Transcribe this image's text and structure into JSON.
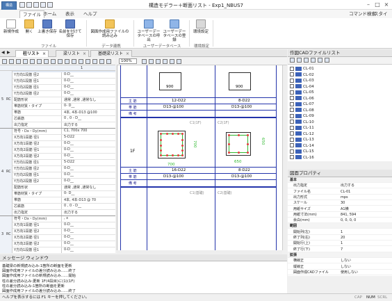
{
  "titlebar": {
    "title": "構造モデラー＋断面リスト - Exp1_NBUS7"
  },
  "ribbon": {
    "tabs": [
      "ファイル",
      "ホーム",
      "表示",
      "ヘルプ"
    ],
    "right_items": [
      "コマンド検索",
      "スタイル"
    ],
    "buttons": [
      {
        "label": "新規作成"
      },
      {
        "label": "開く"
      },
      {
        "label": "上書き保存"
      },
      {
        "label": "名前を付けて保存"
      },
      {
        "label": "図面作成用ファイルの読み込み"
      },
      {
        "label": "ユーザーデータベースの呼出"
      },
      {
        "label": "ユーザーデータベースの登録"
      },
      {
        "label": "環境設定"
      }
    ],
    "groups": [
      "ファイル",
      "データ連携",
      "ユーザーデータベース",
      "環境設定"
    ]
  },
  "doc_tabs": [
    "柱リスト",
    "梁リスト",
    "基礎梁リスト"
  ],
  "left_grid": {
    "header_col": "1",
    "rows": [
      {
        "floor": "5",
        "kind": "RC",
        "items": [
          {
            "k": "Y方向1段筋 径2",
            "v": "0-D__"
          },
          {
            "k": "Y方向1段筋 径1",
            "v": "0-D__"
          },
          {
            "k": "Y方向2段筋 径1",
            "v": "0-D__"
          },
          {
            "k": "Y方向2段筋 径2",
            "v": "0-D__"
          },
          {
            "k": "配筋形状",
            "v": "通常 ,通常 ,通常なし"
          },
          {
            "k": "帯筋材質・タイプ",
            "v": "0- D__"
          },
          {
            "k": "帯筋",
            "v": "4本, 4本-D13 @100"
          },
          {
            "k": "芯鉄筋",
            "v": "0 , 0 - D__"
          },
          {
            "k": "出力指定",
            "v": "出力する"
          }
        ]
      },
      {
        "floor": "4",
        "kind": "RC",
        "items": [
          {
            "k": "符号・Dx・Dy(mm)",
            "v": "C1, 700x 700"
          },
          {
            "k": "X方向1段筋 径1",
            "v": "5-D22"
          },
          {
            "k": "X方向1段筋 径2",
            "v": "0-D__"
          },
          {
            "k": "X方向2段筋 径1",
            "v": "0-D__"
          },
          {
            "k": "X方向2段筋 径2",
            "v": "0-D__"
          },
          {
            "k": "Y方向1段筋 径1",
            "v": "5-D22"
          },
          {
            "k": "Y方向1段筋 径2",
            "v": "0-D__"
          },
          {
            "k": "Y方向2段筋 径1",
            "v": "0-D__"
          },
          {
            "k": "Y方向2段筋 径2",
            "v": "0-D__"
          },
          {
            "k": "配筋形状",
            "v": "通常 ,通常 ,通常なし"
          },
          {
            "k": "帯筋材質・タイプ",
            "v": "0- D__"
          },
          {
            "k": "帯筋",
            "v": "4本, 4本-D13 @ 70"
          },
          {
            "k": "芯鉄筋",
            "v": "0 , 0 - D__"
          },
          {
            "k": "出力指定",
            "v": "出力する"
          }
        ]
      },
      {
        "floor": "3",
        "kind": "RC",
        "items": [
          {
            "k": "符号・Dx・Dy(mm)",
            "v": ",    x"
          },
          {
            "k": "X方向1段筋 径1",
            "v": "0-D__"
          },
          {
            "k": "X方向1段筋 径2",
            "v": "0-D__"
          },
          {
            "k": "X方向2段筋 径1",
            "v": "0-D__"
          },
          {
            "k": "X方向2段筋 径2",
            "v": "0-D__"
          },
          {
            "k": "Y方向1段筋 径1",
            "v": "0-D__"
          }
        ]
      }
    ]
  },
  "canvas": {
    "zoom": "100%",
    "top_rows": [
      "主 筋",
      "帯 筋",
      "備 考"
    ],
    "top_values": [
      [
        "12-D22",
        "8-D22"
      ],
      [
        "D13-@100",
        "D13-@100"
      ]
    ],
    "top_dims": [
      "900",
      "900"
    ],
    "floor_label": "1F",
    "section_labels": [
      "C1(1F)",
      "C2(1F)"
    ],
    "mid_dims": [
      "700",
      "700",
      "650",
      "650"
    ],
    "bottom_rows": [
      "主 筋",
      "帯 筋",
      "備 考"
    ],
    "bottom_values": [
      [
        "16-D22",
        "8-D22"
      ],
      [
        "D13-@100",
        "D13-@100"
      ]
    ],
    "bottom_labels": [
      "C1(基礎)",
      "C2(基礎)"
    ]
  },
  "cad_panel": {
    "title": "作図CADファイルリスト",
    "items": [
      "CL-01",
      "CL-02",
      "CL-03",
      "CL-04",
      "CL-05",
      "CL-06",
      "CL-07",
      "CL-08",
      "CL-09",
      "CL-10",
      "CL-11",
      "CL-12",
      "CL-13",
      "CL-14",
      "CL-15",
      "CL-16"
    ]
  },
  "prop_panel": {
    "title": "図面プロパティ",
    "rows": [
      {
        "k": "基本",
        "v": "",
        "cat": true
      },
      {
        "k": "出力指定",
        "v": "出力する"
      },
      {
        "k": "ファイル名",
        "v": "CL-01"
      },
      {
        "k": "出力形式",
        "v": "mps"
      },
      {
        "k": "スケール",
        "v": "30"
      },
      {
        "k": "用紙サイズ",
        "v": "A1横"
      },
      {
        "k": "用紙寸法(mm)",
        "v": "841, 594"
      },
      {
        "k": "余白(mm)",
        "v": "0, 0, 0, 0"
      },
      {
        "k": "範囲",
        "v": "",
        "cat": true
      },
      {
        "k": "開始列(左)",
        "v": "1"
      },
      {
        "k": "終了列(右)",
        "v": "20"
      },
      {
        "k": "開始行(上)",
        "v": "1"
      },
      {
        "k": "終了行(下)",
        "v": "7"
      },
      {
        "k": "拡張",
        "v": "",
        "cat": true
      },
      {
        "k": "横線正",
        "v": "しない"
      },
      {
        "k": "縦線正",
        "v": "しない"
      },
      {
        "k": "図面作成CADファイル",
        "v": "使用しない"
      }
    ]
  },
  "messages": {
    "title": "メッセージ ウィンドウ",
    "lines": [
      "基礎梁の新規読み込み:1箇所の断面を更新",
      "図面作成用ファイルの差分読み込み……終了",
      "図面作成用ファイルの新規読み込み……開始",
      "柱の差分読み込み:更新 1F(4段目)に(1)(1F)",
      "柱の差分読み込み:1箇所の断面を更新",
      "図面作成用ファイルの差分読み込み……終了"
    ]
  },
  "status": {
    "left": "ヘルプを表示するには F1 キーを押してください。",
    "right": [
      "CAP",
      "NUM",
      "SCRL"
    ]
  },
  "colors": {
    "accent": "#2233aa",
    "rebar": "#2eb82e",
    "marker": "#e23b3b",
    "cad_icon": "#3d63b8"
  }
}
